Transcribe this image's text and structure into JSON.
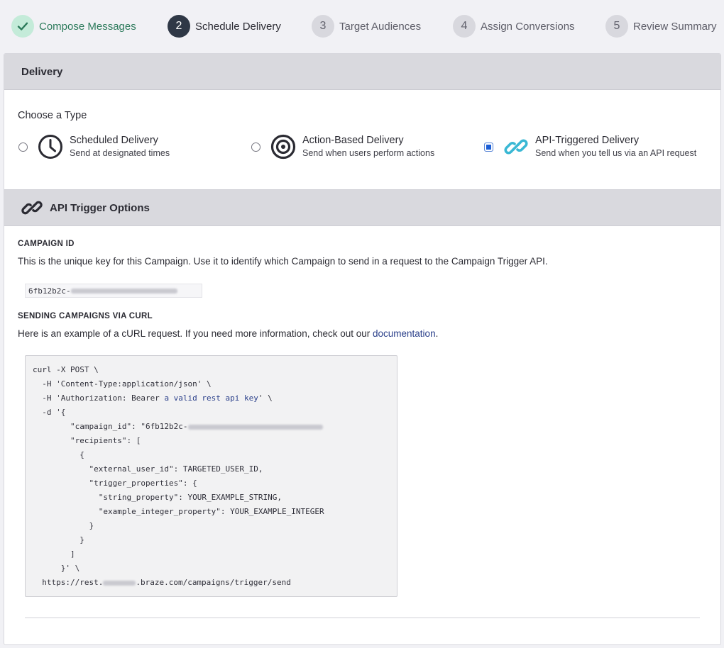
{
  "stepper": {
    "steps": [
      {
        "num": "",
        "label": "Compose Messages",
        "state": "done",
        "icon": "checkmark-icon"
      },
      {
        "num": "2",
        "label": "Schedule Delivery",
        "state": "active"
      },
      {
        "num": "3",
        "label": "Target Audiences",
        "state": "pending"
      },
      {
        "num": "4",
        "label": "Assign Conversions",
        "state": "pending"
      },
      {
        "num": "5",
        "label": "Review Summary",
        "state": "pending"
      }
    ]
  },
  "delivery": {
    "header": "Delivery",
    "choose_label": "Choose a Type",
    "options": [
      {
        "title": "Scheduled Delivery",
        "desc": "Send at designated times",
        "icon": "clock-icon",
        "selected": false
      },
      {
        "title": "Action-Based Delivery",
        "desc": "Send when users perform actions",
        "icon": "target-icon",
        "selected": false
      },
      {
        "title": "API-Triggered Delivery",
        "desc": "Send when you tell us via an API request",
        "icon": "link-icon",
        "selected": true
      }
    ]
  },
  "api": {
    "header": "API Trigger Options",
    "campaign_id_title": "CAMPAIGN ID",
    "campaign_id_desc": "This is the unique key for this Campaign. Use it to identify which Campaign to send in a request to the Campaign Trigger API.",
    "campaign_id_prefix": "6fb12b2c-",
    "curl_title": "SENDING CAMPAIGNS VIA CURL",
    "curl_desc_prefix": "Here is an example of a cURL request. If you need more information, check out our ",
    "curl_desc_link": "documentation",
    "curl_desc_suffix": "."
  },
  "code": {
    "l1": "curl -X POST \\",
    "l2": "  -H 'Content-Type:application/json' \\",
    "l3a": "  -H 'Authorization: Bearer ",
    "l3b": "a valid rest api key",
    "l3c": "' \\",
    "l4": "  -d '{",
    "l5a": "        \"campaign_id\": \"6fb12b2c-",
    "l6": "        \"recipients\": [",
    "l7": "          {",
    "l8": "            \"external_user_id\": TARGETED_USER_ID,",
    "l9": "            \"trigger_properties\": {",
    "l10": "              \"string_property\": YOUR_EXAMPLE_STRING,",
    "l11": "              \"example_integer_property\": YOUR_EXAMPLE_INTEGER",
    "l12": "            }",
    "l13": "          }",
    "l14": "        ]",
    "l15": "      }' \\",
    "l16a": "  https://rest.",
    "l16b": ".braze.com/campaigns/trigger/send"
  },
  "colors": {
    "done_green": "#2c7a5b",
    "active_dark": "#2f3846",
    "link_blue": "#2a3f8a",
    "api_icon_cyan": "#3ab8d4"
  }
}
